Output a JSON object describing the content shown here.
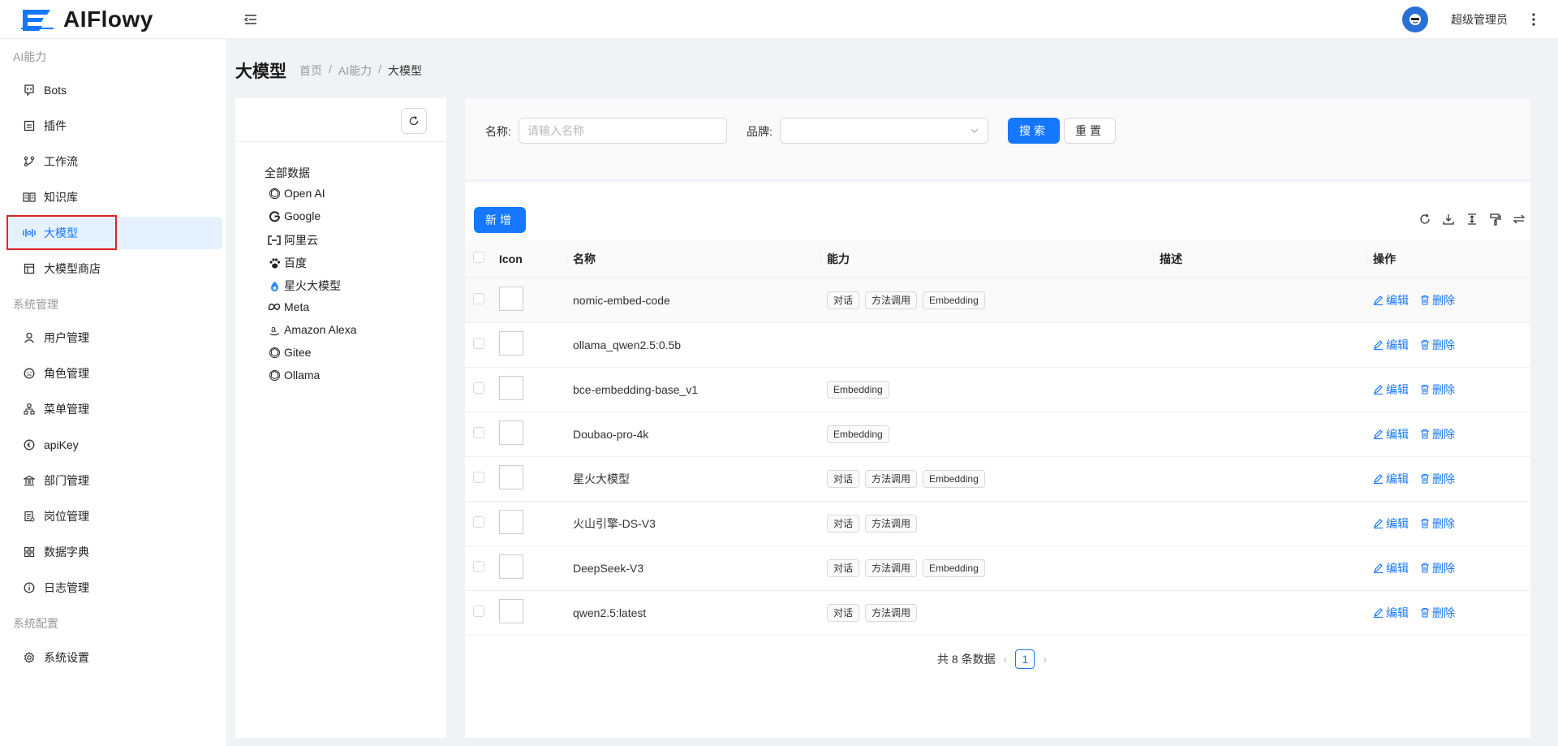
{
  "header": {
    "app_name": "AIFlowy",
    "user_name": "超级管理员"
  },
  "sidebar": {
    "groups": [
      {
        "label": "AI能力"
      },
      {
        "label": "系统管理"
      },
      {
        "label": "系统配置"
      }
    ],
    "items": [
      {
        "label": "Bots",
        "icon": "bot-icon"
      },
      {
        "label": "插件",
        "icon": "plugin-icon"
      },
      {
        "label": "工作流",
        "icon": "workflow-icon"
      },
      {
        "label": "知识库",
        "icon": "book-icon"
      },
      {
        "label": "大模型",
        "icon": "model-icon",
        "active": true
      },
      {
        "label": "大模型商店",
        "icon": "store-icon"
      },
      {
        "label": "用户管理",
        "icon": "user-icon"
      },
      {
        "label": "角色管理",
        "icon": "role-icon"
      },
      {
        "label": "菜单管理",
        "icon": "menu-tree-icon"
      },
      {
        "label": "apiKey",
        "icon": "key-icon"
      },
      {
        "label": "部门管理",
        "icon": "building-icon"
      },
      {
        "label": "岗位管理",
        "icon": "post-icon"
      },
      {
        "label": "数据字典",
        "icon": "grid-icon"
      },
      {
        "label": "日志管理",
        "icon": "info-icon"
      },
      {
        "label": "系统设置",
        "icon": "gear-icon"
      }
    ]
  },
  "page": {
    "title": "大模型",
    "breadcrumb": [
      "首页",
      "AI能力",
      "大模型"
    ]
  },
  "brands": {
    "all_label": "全部数据",
    "items": [
      {
        "label": "Open AI",
        "icon": "openai-icon"
      },
      {
        "label": "Google",
        "icon": "google-icon"
      },
      {
        "label": "阿里云",
        "icon": "aliyun-icon"
      },
      {
        "label": "百度",
        "icon": "baidu-icon"
      },
      {
        "label": "星火大模型",
        "icon": "spark-icon"
      },
      {
        "label": "Meta",
        "icon": "meta-icon"
      },
      {
        "label": "Amazon Alexa",
        "icon": "amazon-icon"
      },
      {
        "label": "Gitee",
        "icon": "openai-icon"
      },
      {
        "label": "Ollama",
        "icon": "openai-icon"
      }
    ]
  },
  "search": {
    "name_label": "名称:",
    "name_placeholder": "请输入名称",
    "brand_label": "品牌:",
    "search_button": "搜索",
    "reset_button": "重置"
  },
  "toolbar": {
    "add_button": "新增"
  },
  "table": {
    "columns": [
      "Icon",
      "名称",
      "能力",
      "描述",
      "操作"
    ],
    "edit_label": "编辑",
    "delete_label": "删除",
    "rows": [
      {
        "name": "nomic-embed-code",
        "tags": [
          "对话",
          "方法调用",
          "Embedding"
        ]
      },
      {
        "name": "ollama_qwen2.5:0.5b",
        "tags": []
      },
      {
        "name": "bce-embedding-base_v1",
        "tags": [
          "Embedding"
        ]
      },
      {
        "name": "Doubao-pro-4k",
        "tags": [
          "Embedding"
        ]
      },
      {
        "name": "星火大模型",
        "tags": [
          "对话",
          "方法调用",
          "Embedding"
        ]
      },
      {
        "name": "火山引擎-DS-V3",
        "tags": [
          "对话",
          "方法调用"
        ]
      },
      {
        "name": "DeepSeek-V3",
        "tags": [
          "对话",
          "方法调用",
          "Embedding"
        ]
      },
      {
        "name": "qwen2.5:latest",
        "tags": [
          "对话",
          "方法调用"
        ]
      }
    ]
  },
  "pagination": {
    "total_text": "共 8 条数据",
    "current_page": "1"
  },
  "colors": {
    "primary": "#1677ff",
    "active_bg": "#e6f1ff",
    "highlight_border": "#e02424"
  }
}
